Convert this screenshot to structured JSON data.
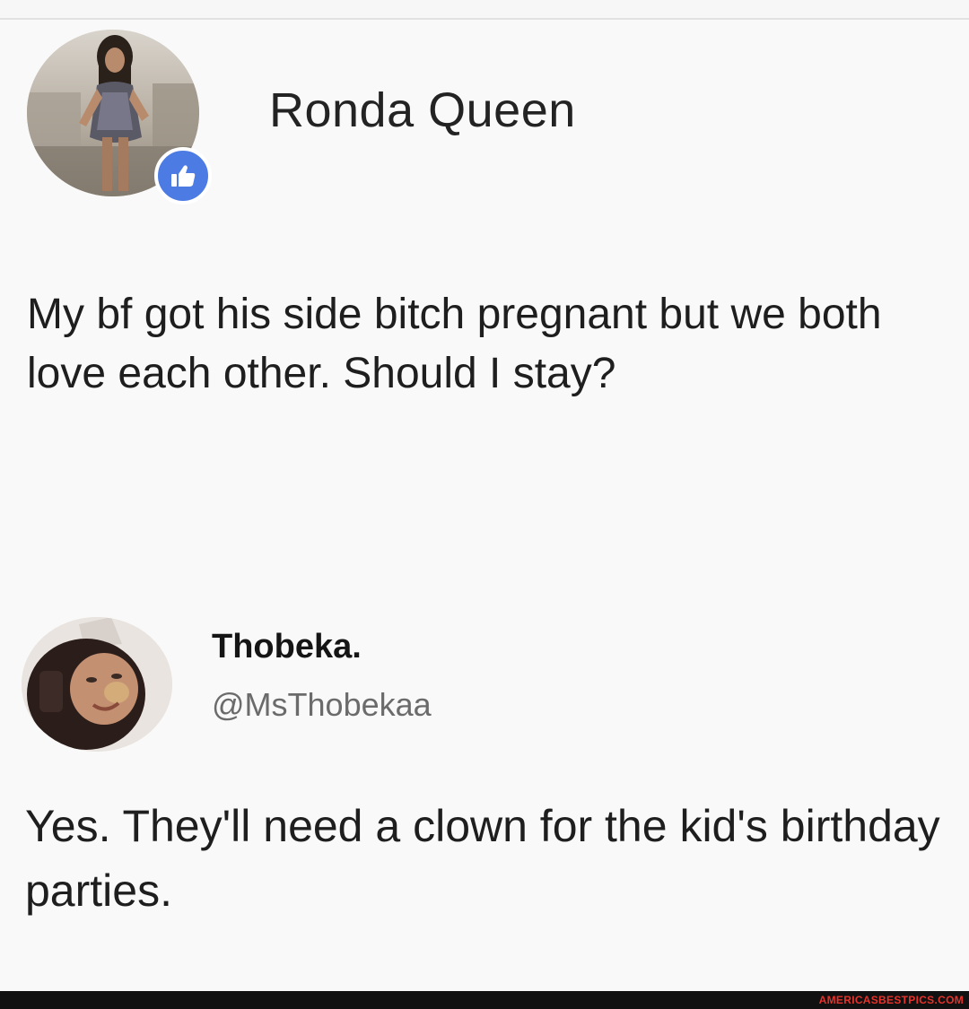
{
  "post": {
    "author_name": "Ronda Queen",
    "text": "My bf got his side bitch pregnant but we both love each other. Should I stay?",
    "avatar_icon": "profile-photo-woman",
    "badge_icon": "thumbs-up-icon",
    "badge_color": "#4c7be3"
  },
  "reply": {
    "author_name": "Thobeka.",
    "handle": "@MsThobekaa",
    "text": "Yes. They'll need a clown for the kid's birthday parties.",
    "avatar_icon": "profile-photo-woman-selfie"
  },
  "footer": {
    "watermark": "AMERICASBESTPICS.COM",
    "watermark_color": "#e8322b"
  }
}
